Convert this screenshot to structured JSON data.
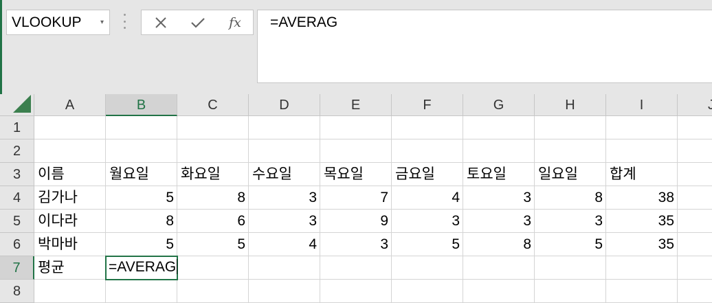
{
  "name_box": {
    "value": "VLOOKUP",
    "dropdown": "▾"
  },
  "formula_bar": {
    "cancel_icon": "✕",
    "enter_icon": "✓",
    "fx_label": "fx",
    "value": "=AVERAG"
  },
  "columns": [
    "A",
    "B",
    "C",
    "D",
    "E",
    "F",
    "G",
    "H",
    "I",
    "J"
  ],
  "selected_column": "B",
  "rows": [
    "1",
    "2",
    "3",
    "4",
    "5",
    "6",
    "7",
    "8"
  ],
  "selected_row": "7",
  "sheet": {
    "r3": [
      "이름",
      "월요일",
      "화요일",
      "수요일",
      "목요일",
      "금요일",
      "토요일",
      "일요일",
      "합계"
    ],
    "r4": [
      "김가나",
      "5",
      "8",
      "3",
      "7",
      "4",
      "3",
      "8",
      "38"
    ],
    "r5": [
      "이다라",
      "8",
      "6",
      "3",
      "9",
      "3",
      "3",
      "3",
      "35"
    ],
    "r6": [
      "박마바",
      "5",
      "5",
      "4",
      "3",
      "5",
      "8",
      "5",
      "35"
    ],
    "r7": [
      "평균",
      "=AVERAG"
    ]
  },
  "colors": {
    "accent": "#217346"
  }
}
